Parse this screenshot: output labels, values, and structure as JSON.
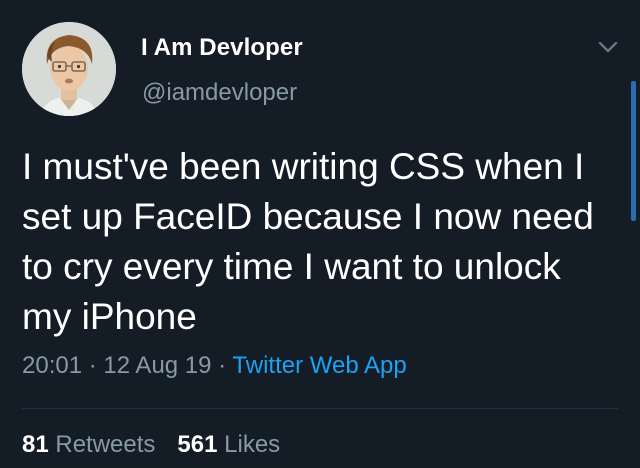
{
  "author": {
    "display_name": "I Am Devloper",
    "handle": "@iamdevloper",
    "avatar_icon": "profile-avatar"
  },
  "menu_icon": "chevron-down-icon",
  "tweet": {
    "text": "I must've been writing CSS when I\nset up FaceID because I now need\nto cry every time I want to unlock\nmy iPhone"
  },
  "meta": {
    "time": "20:01",
    "separator": " · ",
    "date": "12 Aug 19",
    "source": "Twitter Web App"
  },
  "stats": {
    "retweets_count": "81",
    "retweets_label": "Retweets",
    "likes_count": "561",
    "likes_label": "Likes"
  },
  "colors": {
    "background": "#141d26",
    "text": "#ffffff",
    "secondary": "#8899a6",
    "link": "#1da1f2"
  }
}
